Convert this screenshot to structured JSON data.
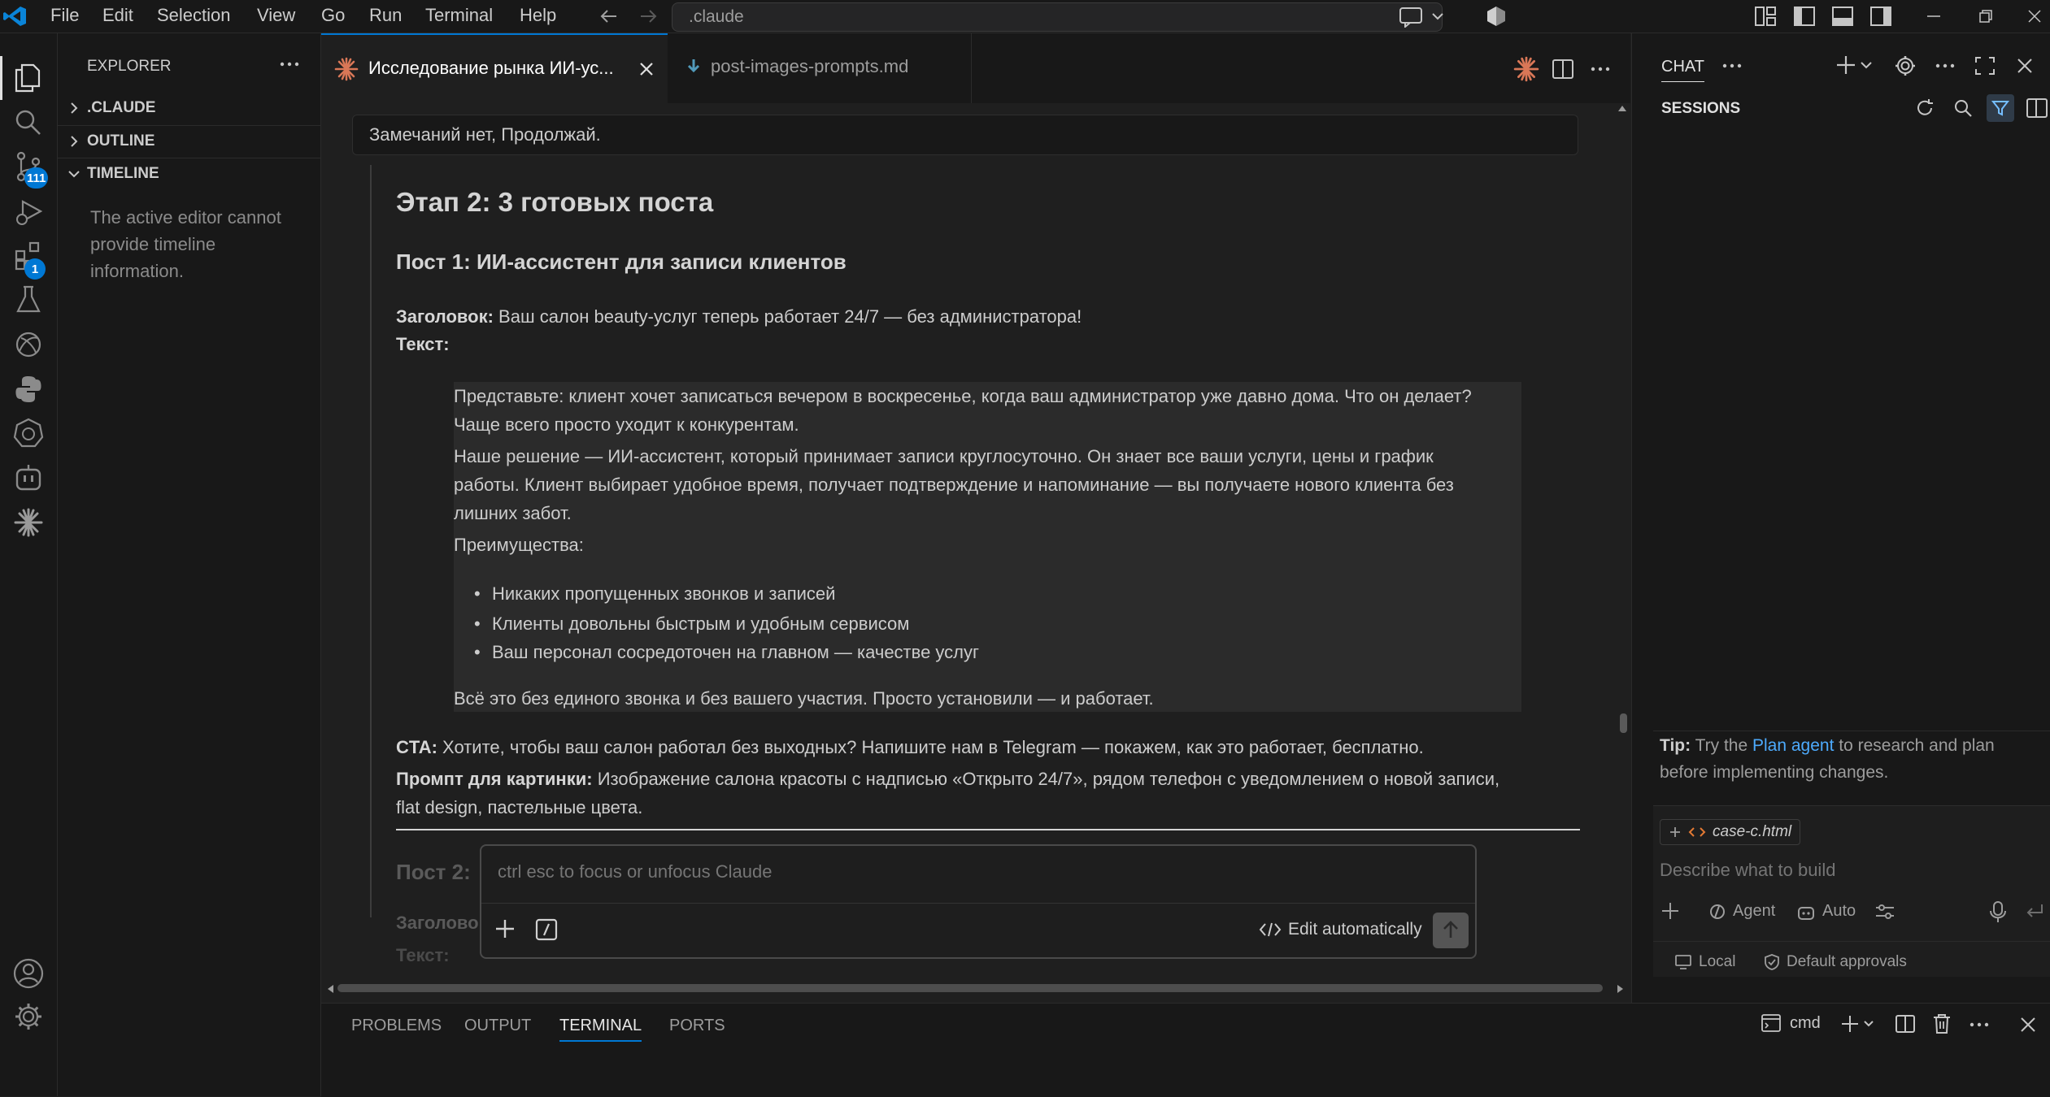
{
  "titlebar": {
    "menu": [
      "File",
      "Edit",
      "Selection",
      "View",
      "Go",
      "Run",
      "Terminal",
      "Help"
    ],
    "search_text": ".claude"
  },
  "activity": {
    "scm_badge": "111",
    "extensions_badge": "1"
  },
  "explorer": {
    "title": "EXPLORER",
    "sections": [
      ".CLAUDE",
      "OUTLINE",
      "TIMELINE"
    ],
    "timeline_message": "The active editor cannot provide timeline information."
  },
  "tabs": [
    {
      "label": "Исследование рынка ИИ-ус...",
      "active": true
    },
    {
      "label": "post-images-prompts.md",
      "active": false
    }
  ],
  "conversation": {
    "user_message": "Замечаний нет, Продолжай.",
    "heading": "Этап 2: 3 готовых поста",
    "post1": {
      "title": "Пост 1: ИИ-ассистент для записи клиентов",
      "headline_label": "Заголовок:",
      "headline": "Ваш салон beauty-услуг теперь работает 24/7 — без администратора!",
      "text_label": "Текст:",
      "quote_lines": [
        "Представьте: клиент хочет записаться вечером в воскресенье, когда ваш администратор уже давно дома. Что он делает?",
        "Чаще всего просто уходит к конкурентам.",
        "Наше решение — ИИ-ассистент, который принимает записи круглосуточно. Он знает все ваши услуги, цены и график",
        "работы. Клиент выбирает удобное время, получает подтверждение и напоминание — вы получаете нового клиента без",
        "лишних забот.",
        "Преимущества:"
      ],
      "benefits": [
        "Никаких пропущенных звонков и записей",
        "Клиенты довольны быстрым и удобным сервисом",
        "Ваш персонал сосредоточен на главном — качестве услуг"
      ],
      "closing": "Всё это без единого звонка и без вашего участия. Просто установили — и работает.",
      "cta_label": "CTA:",
      "cta": "Хотите, чтобы ваш салон работал без выходных? Напишите нам в Telegram — покажем, как это работает, бесплатно.",
      "prompt_label": "Промпт для картинки:",
      "prompt_line1": "Изображение салона красоты с надписью «Открыто 24/7», рядом телефон с уведомлением о новой записи,",
      "prompt_line2": "flat design, пастельные цвета."
    },
    "post2_partial": "Пост 2:",
    "post2_headline_partial": "Заголово",
    "post2_text_partial": "Текст:"
  },
  "claude_input": {
    "placeholder": "ctrl esc to focus or unfocus Claude",
    "mode_label": "Edit automatically"
  },
  "chat": {
    "tab_label": "CHAT",
    "sessions_label": "SESSIONS",
    "tip_label": "Tip:",
    "tip_pre": "Try the",
    "tip_link": "Plan agent",
    "tip_post": "to research and plan before implementing changes.",
    "context_file": "case-c.html",
    "input_placeholder": "Describe what to build",
    "agent_label": "Agent",
    "auto_label": "Auto",
    "local_label": "Local",
    "approvals_label": "Default approvals"
  },
  "panel": {
    "tabs": [
      "PROBLEMS",
      "OUTPUT",
      "TERMINAL",
      "PORTS"
    ],
    "active_tab": "TERMINAL",
    "terminal_name": "cmd"
  },
  "colors": {
    "accent": "#0078d4",
    "link": "#4daafc",
    "claude_orange": "#d97757"
  }
}
